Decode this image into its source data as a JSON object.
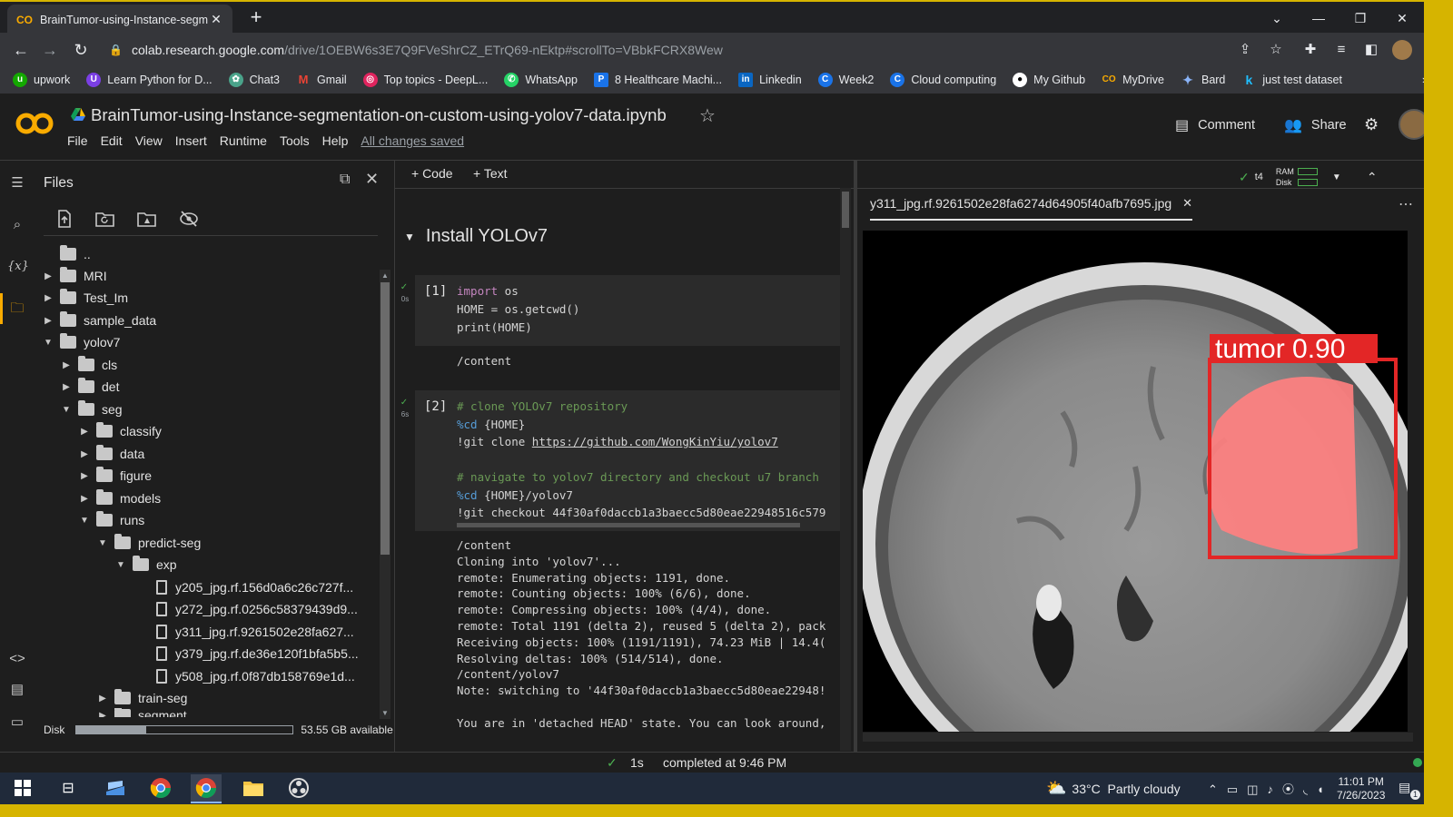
{
  "browser": {
    "tab_title": "BrainTumor-using-Instance-segm",
    "new_tab": "+",
    "url_host": "colab.research.google.com",
    "url_path": "/drive/1OEBW6s3E7Q9FVeShrCZ_ETrQ69-nEktp#scrollTo=VBbkFCRX8Wew",
    "bookmarks": [
      {
        "label": "upwork",
        "color": "#14a800"
      },
      {
        "label": "Learn Python for D...",
        "color": "#7b3fe4"
      },
      {
        "label": "Chat3",
        "color": "#4aa38a"
      },
      {
        "label": "Gmail",
        "color": "#ea4335"
      },
      {
        "label": "Top topics - DeepL...",
        "color": "#e0245e"
      },
      {
        "label": "WhatsApp",
        "color": "#25d366"
      },
      {
        "label": "8 Healthcare Machi...",
        "color": "#1a73e8"
      },
      {
        "label": "Linkedin",
        "color": "#0a66c2"
      },
      {
        "label": "Week2",
        "color": "#1a73e8"
      },
      {
        "label": "Cloud computing",
        "color": "#1a73e8"
      },
      {
        "label": "My Github",
        "color": "#ffffff"
      },
      {
        "label": "MyDrive",
        "color": "#f9ab00"
      },
      {
        "label": "Bard",
        "color": "#8ab4f8"
      },
      {
        "label": "just test dataset",
        "color": "#1a73e8"
      }
    ],
    "overflow": "»"
  },
  "colab": {
    "notebook_title": "BrainTumor-using-Instance-segmentation-on-custom-using-yolov7-data.ipynb",
    "menu": [
      "File",
      "Edit",
      "View",
      "Insert",
      "Runtime",
      "Tools",
      "Help"
    ],
    "saved_status": "All changes saved",
    "comment_label": "Comment",
    "share_label": "Share",
    "add_code": "+ Code",
    "add_text": "+ Text",
    "runtime_name": "t4",
    "ram_label": "RAM",
    "disk_label": "Disk",
    "accent": "#f9ab00"
  },
  "files_panel": {
    "title": "Files",
    "tree": [
      {
        "label": "..",
        "type": "up"
      },
      {
        "label": "MRI",
        "type": "folder"
      },
      {
        "label": "Test_Im",
        "type": "folder"
      },
      {
        "label": "sample_data",
        "type": "folder"
      },
      {
        "label": "yolov7",
        "type": "folder"
      },
      {
        "label": "cls",
        "type": "folder"
      },
      {
        "label": "det",
        "type": "folder"
      },
      {
        "label": "seg",
        "type": "folder"
      },
      {
        "label": "classify",
        "type": "folder"
      },
      {
        "label": "data",
        "type": "folder"
      },
      {
        "label": "figure",
        "type": "folder"
      },
      {
        "label": "models",
        "type": "folder"
      },
      {
        "label": "runs",
        "type": "folder"
      },
      {
        "label": "predict-seg",
        "type": "folder"
      },
      {
        "label": "exp",
        "type": "folder"
      },
      {
        "label": "y205_jpg.rf.156d0a6c26c727f...",
        "type": "file"
      },
      {
        "label": "y272_jpg.rf.0256c58379439d9...",
        "type": "file"
      },
      {
        "label": "y311_jpg.rf.9261502e28fa627...",
        "type": "file"
      },
      {
        "label": "y379_jpg.rf.de36e120f1bfa5b5...",
        "type": "file"
      },
      {
        "label": "y508_jpg.rf.0f87db158769e1d...",
        "type": "file"
      },
      {
        "label": "train-seg",
        "type": "folder"
      },
      {
        "label": "segment",
        "type": "folder"
      }
    ],
    "disk_label": "Disk",
    "disk_available": "53.55 GB available",
    "disk_used_fraction": 0.32
  },
  "notebook": {
    "section_title": "Install YOLOv7",
    "cell1": {
      "exec": "[1]",
      "runtime": "0s",
      "output": "/content"
    },
    "cell2": {
      "exec": "[2]",
      "runtime": "6s",
      "output": "/content\nCloning into 'yolov7'...\nremote: Enumerating objects: 1191, done.\nremote: Counting objects: 100% (6/6), done.\nremote: Compressing objects: 100% (4/4), done.\nremote: Total 1191 (delta 2), reused 5 (delta 2), pack\nReceiving objects: 100% (1191/1191), 74.23 MiB | 14.4(\nResolving deltas: 100% (514/514), done.\n/content/yolov7\nNote: switching to '44f30af0daccb1a3baecc5d80eae22948!\n\nYou are in 'detached HEAD' state. You can look around,"
    }
  },
  "viewer": {
    "file_tab": "y311_jpg.rf.9261502e28fa6274d64905f40afb7695.jpg",
    "detection_label": "tumor 0.90",
    "box_color": "#e32626",
    "mask_color": "#ff8080"
  },
  "status_bar": {
    "duration": "1s",
    "message": "completed at 9:46 PM"
  },
  "taskbar": {
    "weather": "33°C  Partly cloudy",
    "time": "11:01 PM",
    "date": "7/26/2023",
    "notification_count": "1"
  }
}
